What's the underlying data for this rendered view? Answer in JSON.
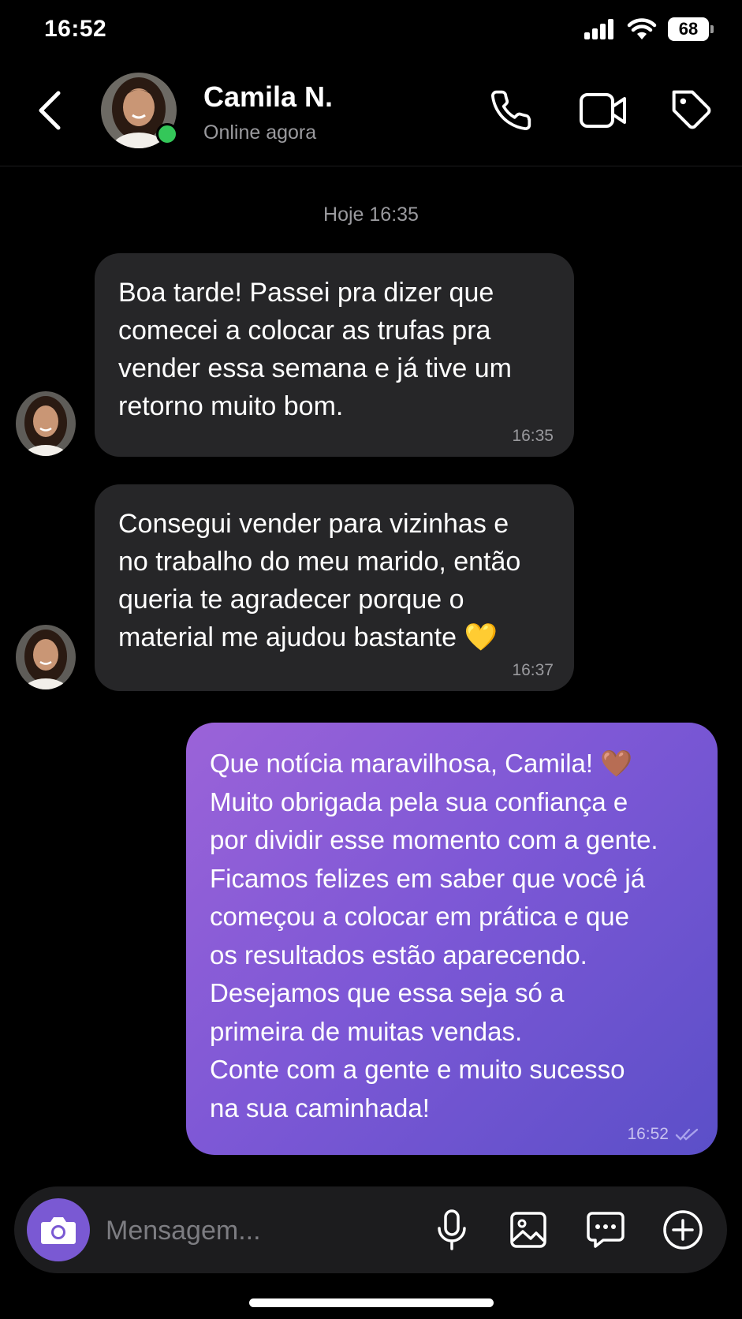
{
  "status_bar": {
    "time": "16:52",
    "battery": "68"
  },
  "header": {
    "contact_name": "Camila N.",
    "contact_status": "Online agora"
  },
  "date_separator": "Hoje 16:35",
  "messages": [
    {
      "direction": "incoming",
      "text": "Boa tarde! Passei pra dizer que\ncomecei a colocar as trufas pra\nvender essa semana  e já tive um\nretorno muito bom.",
      "time": "16:35"
    },
    {
      "direction": "incoming",
      "text": "Consegui vender para vizinhas e\nno trabalho do meu marido, então\nqueria te agradecer porque o\nmaterial me ajudou bastante 💛",
      "time": "16:37"
    },
    {
      "direction": "outgoing",
      "text": "Que notícia maravilhosa, Camila! 🤎\nMuito obrigada pela sua confiança e\npor dividir esse momento com a gente.\nFicamos felizes em saber que você já\ncomeçou a colocar em prática e que\nos resultados estão aparecendo.\nDesejamos que essa seja só a\nprimeira de muitas vendas.\nConte com a gente e muito sucesso\nna sua caminhada!",
      "time": "16:52",
      "status": "read"
    }
  ],
  "composer": {
    "placeholder": "Mensagem..."
  },
  "colors": {
    "background": "#000000",
    "incoming_bubble": "#262628",
    "outgoing_gradient_start": "#9b63d8",
    "outgoing_gradient_end": "#5b4fc8",
    "accent": "#7a59d3",
    "online": "#34c759"
  },
  "icons": [
    "back-chevron-icon",
    "phone-icon",
    "video-camera-icon",
    "tag-icon",
    "camera-icon",
    "microphone-icon",
    "image-icon",
    "chat-bubble-icon",
    "plus-circle-icon",
    "read-checkmarks-icon"
  ]
}
